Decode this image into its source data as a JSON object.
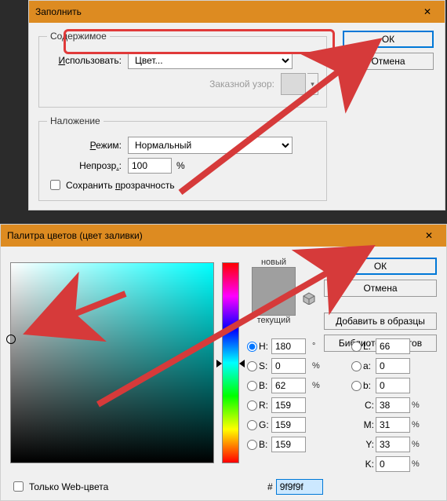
{
  "fill": {
    "title": "Заполнить",
    "ok": "ОК",
    "cancel": "Отмена",
    "group_contents": "Содержимое",
    "use_label_pre": "И",
    "use_label_post": "спользовать:",
    "use_value": "Цвет...",
    "pattern_label": "Заказной узор:",
    "group_blend": "Наложение",
    "mode_label_pre": "Р",
    "mode_label_post": "ежим:",
    "mode_value": "Нормальный",
    "opacity_label_pre": "Непрозр",
    "opacity_label_post": ".:",
    "opacity_value": "100",
    "pct": "%",
    "preserve_pre": "Сохранить ",
    "preserve_u": "п",
    "preserve_post": "розрачность"
  },
  "picker": {
    "title": "Палитра цветов (цвет заливки)",
    "ok": "ОК",
    "cancel": "Отмена",
    "add": "Добавить в образцы",
    "libs": "Библиотеки цветов",
    "new_label": "новый",
    "cur_label": "текущий",
    "new_color": "#9f9f9f",
    "cur_color": "#9f9f9f",
    "H": "H:",
    "Hv": "180",
    "deg": "°",
    "S": "S:",
    "Sv": "0",
    "B": "B:",
    "Bv": "62",
    "R": "R:",
    "Rv": "159",
    "G": "G:",
    "Gv": "159",
    "Bb": "B:",
    "Bbv": "159",
    "L": "L:",
    "Lv": "66",
    "a": "a:",
    "av": "0",
    "b": "b:",
    "bv": "0",
    "C": "C:",
    "Cv": "38",
    "M": "M:",
    "Mv": "31",
    "Y": "Y:",
    "Yv": "33",
    "K": "K:",
    "Kv": "0",
    "pct": "%",
    "web": "Только Web-цвета",
    "hash": "#",
    "hex": "9f9f9f"
  }
}
